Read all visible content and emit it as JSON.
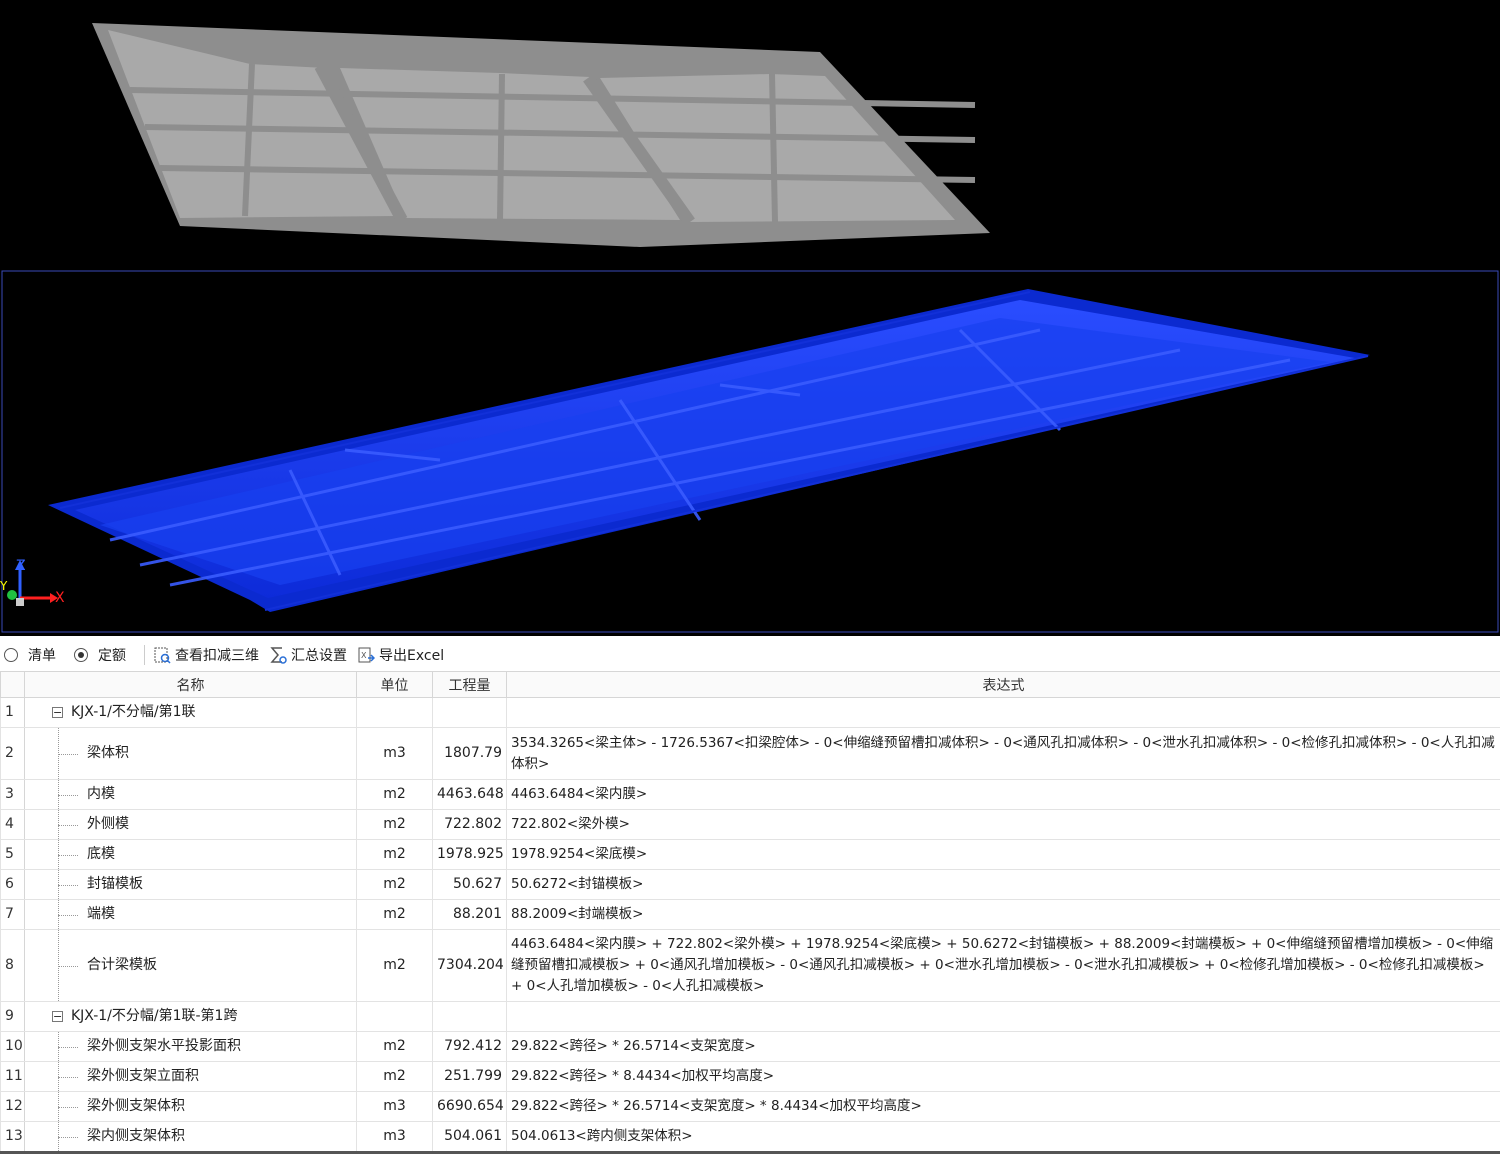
{
  "viewport": {
    "axis_labels": {
      "z": "Z",
      "x": "X",
      "y": "Y"
    },
    "colors": {
      "background": "#000000",
      "upper_slab": "#9a9a9a",
      "lower_slab": "#1a3cff"
    }
  },
  "toolbar": {
    "radio_list": "清单",
    "radio_quota": "定额",
    "radio_selected": "定额",
    "view_3d_label": "查看扣减三维",
    "summary_label": "汇总设置",
    "export_label": "导出Excel"
  },
  "table": {
    "headers": {
      "row": "",
      "name": "名称",
      "unit": "单位",
      "qty": "工程量",
      "expr": "表达式"
    },
    "rows": [
      {
        "no": "1",
        "type": "group",
        "name": "KJX-1/不分幅/第1联",
        "unit": "",
        "qty": "",
        "expr": ""
      },
      {
        "no": "2",
        "type": "child",
        "name": "梁体积",
        "unit": "m3",
        "qty": "1807.79",
        "expr": "3534.3265<梁主体> - 1726.5367<扣梁腔体> - 0<伸缩缝预留槽扣减体积> - 0<通风孔扣减体积> - 0<泄水孔扣减体积> - 0<检修孔扣减体积> - 0<人孔扣减体积>"
      },
      {
        "no": "3",
        "type": "child",
        "name": "内模",
        "unit": "m2",
        "qty": "4463.648",
        "expr": "4463.6484<梁内膜>"
      },
      {
        "no": "4",
        "type": "child",
        "name": "外侧模",
        "unit": "m2",
        "qty": "722.802",
        "expr": "722.802<梁外模>"
      },
      {
        "no": "5",
        "type": "child",
        "name": "底模",
        "unit": "m2",
        "qty": "1978.925",
        "expr": "1978.9254<梁底模>"
      },
      {
        "no": "6",
        "type": "child",
        "name": "封锚模板",
        "unit": "m2",
        "qty": "50.627",
        "expr": "50.6272<封锚模板>"
      },
      {
        "no": "7",
        "type": "child",
        "name": "端模",
        "unit": "m2",
        "qty": "88.201",
        "expr": "88.2009<封端模板>"
      },
      {
        "no": "8",
        "type": "child",
        "name": "合计梁模板",
        "unit": "m2",
        "qty": "7304.204",
        "expr": "4463.6484<梁内膜> + 722.802<梁外模> + 1978.9254<梁底模> + 50.6272<封锚模板> + 88.2009<封端模板> + 0<伸缩缝预留槽增加模板> - 0<伸缩缝预留槽扣减模板> + 0<通风孔增加模板> - 0<通风孔扣减模板> + 0<泄水孔增加模板> - 0<泄水孔扣减模板> + 0<检修孔增加模板> - 0<检修孔扣减模板> + 0<人孔增加模板> - 0<人孔扣减模板>"
      },
      {
        "no": "9",
        "type": "group",
        "name": "KJX-1/不分幅/第1联-第1跨",
        "unit": "",
        "qty": "",
        "expr": ""
      },
      {
        "no": "10",
        "type": "child",
        "name": "梁外侧支架水平投影面积",
        "unit": "m2",
        "qty": "792.412",
        "expr": "29.822<跨径> * 26.5714<支架宽度>"
      },
      {
        "no": "11",
        "type": "child",
        "name": "梁外侧支架立面积",
        "unit": "m2",
        "qty": "251.799",
        "expr": "29.822<跨径> * 8.4434<加权平均高度>"
      },
      {
        "no": "12",
        "type": "child",
        "name": "梁外侧支架体积",
        "unit": "m3",
        "qty": "6690.654",
        "expr": "29.822<跨径> * 26.5714<支架宽度> * 8.4434<加权平均高度>"
      },
      {
        "no": "13",
        "type": "child",
        "name": "梁内侧支架体积",
        "unit": "m3",
        "qty": "504.061",
        "expr": "504.0613<跨内侧支架体积>"
      }
    ]
  }
}
